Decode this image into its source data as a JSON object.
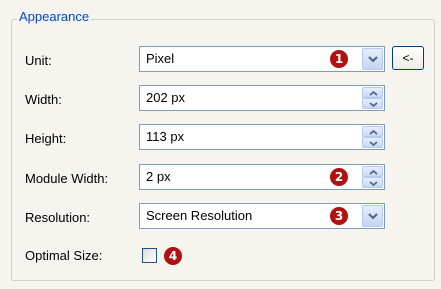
{
  "group": {
    "title": "Appearance"
  },
  "unit": {
    "label": "Unit:",
    "value": "Pixel",
    "badge": "1",
    "back_label": "<-"
  },
  "width": {
    "label": "Width:",
    "value": "202 px"
  },
  "height": {
    "label": "Height:",
    "value": "113 px"
  },
  "module_width": {
    "label": "Module Width:",
    "value": "2 px",
    "badge": "2"
  },
  "resolution": {
    "label": "Resolution:",
    "value": "Screen Resolution",
    "badge": "3"
  },
  "optimal_size": {
    "label": "Optimal Size:",
    "checked": false,
    "badge": "4"
  },
  "colors": {
    "title": "#0046d5",
    "badge": "#b01212",
    "field_border": "#7f9db9",
    "panel": "#f5f4ef"
  },
  "icons": [
    "chevron-down-icon",
    "spin-up-icon",
    "spin-down-icon"
  ]
}
